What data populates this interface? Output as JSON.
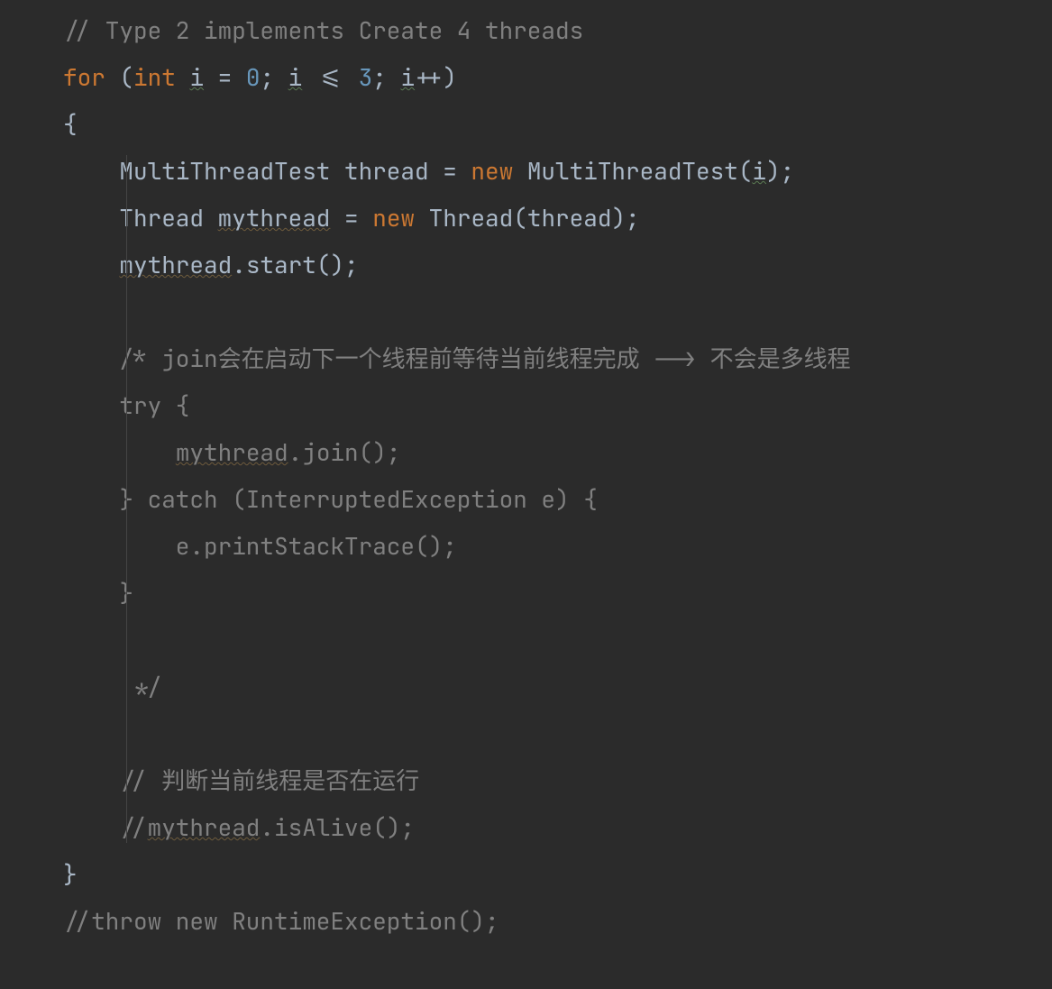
{
  "code": {
    "c1": "// Type 2 implements Create 4 threads",
    "for_kw": "for",
    "lparen": " (",
    "int_kw": "int",
    "sp": " ",
    "i1": "i",
    "eq": " = ",
    "zero": "0",
    "semi": "; ",
    "i2": "i",
    "lte": " <= ",
    "three": "3",
    "i3": "i",
    "pp": "++)",
    "lbrace": "{",
    "line_mt1": "    MultiThreadTest thread = ",
    "new1": "new",
    "line_mt2": " MultiThreadTest(",
    "i4": "i",
    "line_mt3": ");",
    "line_th1": "    Thread ",
    "mythread1": "mythread",
    "line_th2": " = ",
    "new2": "new",
    "line_th3": " Thread(thread);",
    "line_start1": "    ",
    "mythread2": "mythread",
    "line_start2": ".start();",
    "blank": "",
    "cj_open": "    /* join会在启动下一个线程前等待当前线程完成 --> 不会是多线程",
    "cj_try": "    try {",
    "cj_join1": "        ",
    "mythread3": "mythread",
    "cj_join2": ".join();",
    "cj_catch": "    } catch (InterruptedException e) {",
    "cj_stack": "        e.printStackTrace();",
    "cj_end": "    }",
    "cj_close": "     */",
    "c_alive_cn": "    // 判断当前线程是否在运行",
    "c_alive1": "    //",
    "mythread4": "mythread",
    "c_alive2": ".isAlive();",
    "rbrace": "}",
    "c_throw": "//throw new RuntimeException();"
  }
}
